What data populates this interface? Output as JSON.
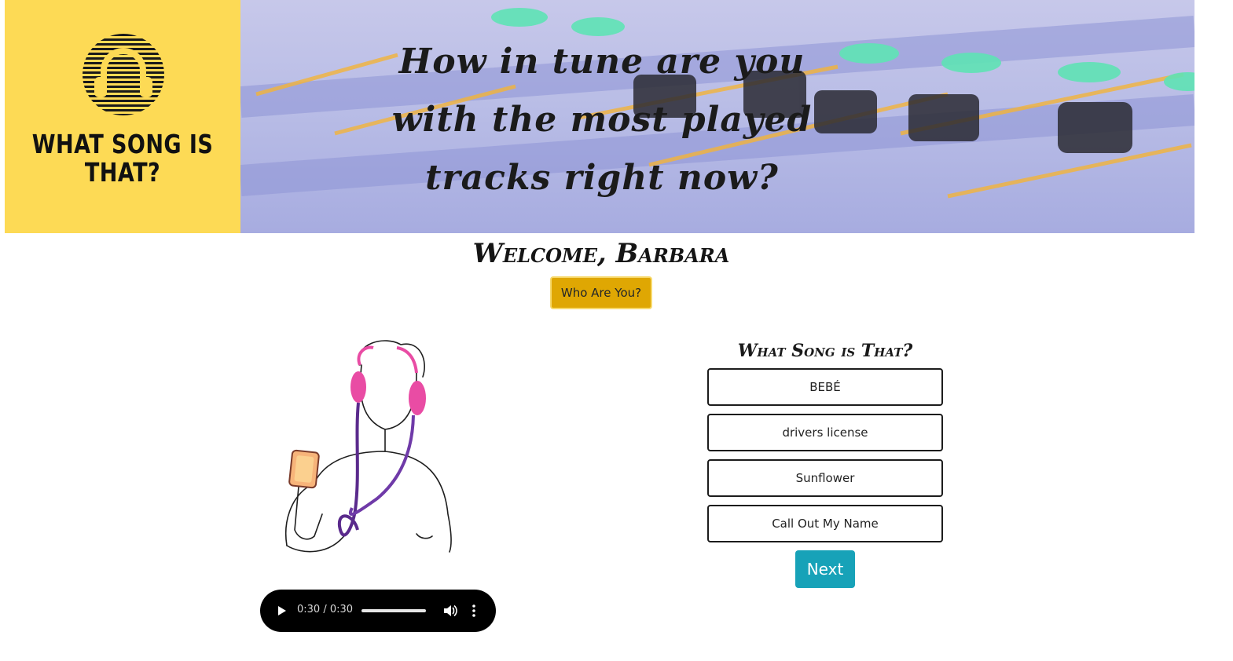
{
  "header": {
    "logo_text": "WHAT SONG IS THAT?",
    "banner_text": "How in tune are you with the most played tracks right now?"
  },
  "welcome": {
    "greeting": "Welcome, Barbara",
    "who_button": "Who Are You?"
  },
  "player": {
    "time": "0:30 / 0:30",
    "icons": [
      "play-icon",
      "volume-icon",
      "more-options-icon"
    ]
  },
  "quiz": {
    "title": "What Song is That?",
    "answers": [
      "BEBÉ",
      "drivers license",
      "Sunflower",
      "Call Out My Name"
    ],
    "next_label": "Next"
  },
  "colors": {
    "logo_bg": "#fdda55",
    "who_button_bg": "#dfa703",
    "next_button_bg": "#17a2b8",
    "headphone_pink": "#e94ca4",
    "cable_purple": "#5a2a8c"
  }
}
